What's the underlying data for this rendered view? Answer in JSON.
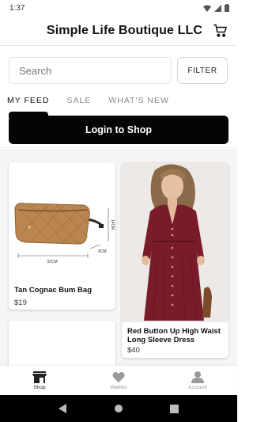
{
  "status_bar": {
    "time": "1:37"
  },
  "header": {
    "title": "Simple Life Boutique LLC",
    "cart_icon": "cart-icon"
  },
  "search": {
    "placeholder": "Search",
    "filter_label": "FILTER"
  },
  "tabs": [
    {
      "label": "MY FEED",
      "active": true
    },
    {
      "label": "SALE",
      "active": false
    },
    {
      "label": "WHAT'S NEW",
      "active": false
    }
  ],
  "login": {
    "label": "Login to Shop"
  },
  "products": [
    {
      "name": "Tan Cognac Bum Bag",
      "price": "$19",
      "image_labels": {
        "width": "32CM",
        "depth": "9CM",
        "height": "14CM"
      }
    },
    {
      "name": "Red Button Up High Waist Long Sleeve Dress",
      "price": "$40"
    }
  ],
  "bottom_nav": [
    {
      "label": "Shop",
      "icon": "store-icon",
      "active": true
    },
    {
      "label": "Waitlist",
      "icon": "heart-icon",
      "active": false
    },
    {
      "label": "Account",
      "icon": "person-icon",
      "active": false
    }
  ],
  "colors": {
    "accent": "#050505",
    "text": "#111111",
    "muted": "#888888",
    "feed_bg": "#f5f5f5"
  }
}
